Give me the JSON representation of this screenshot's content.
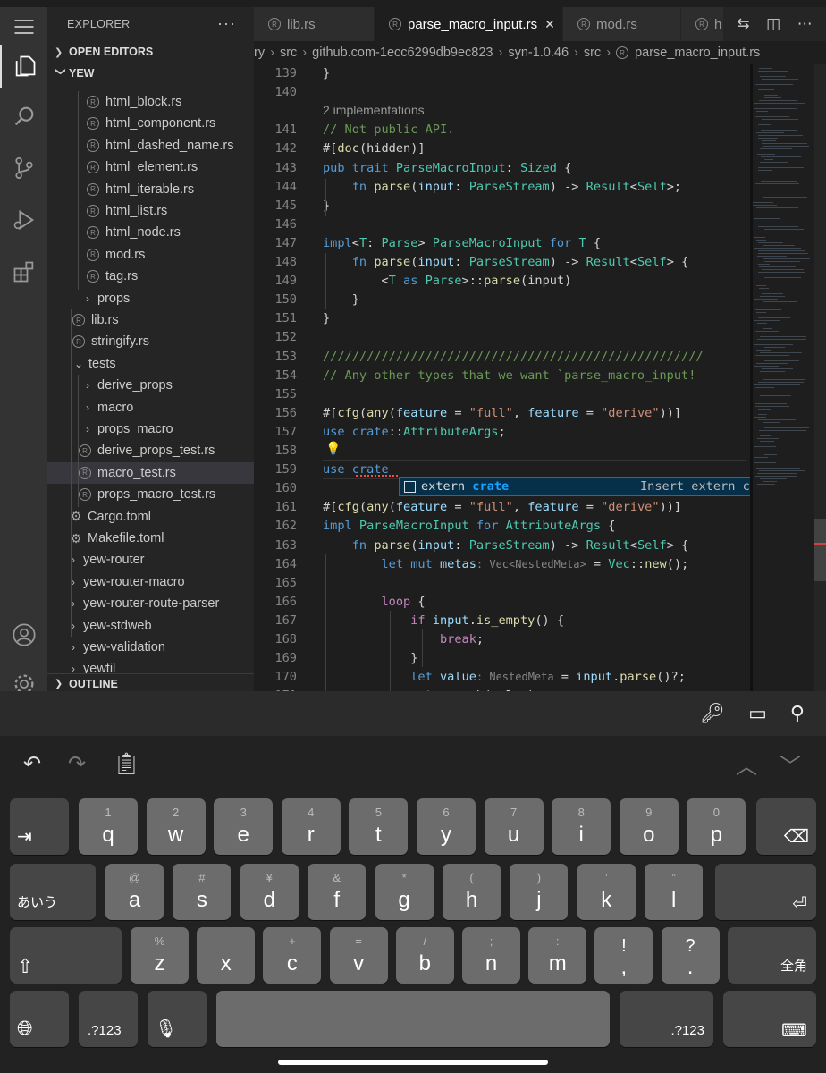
{
  "sidebar": {
    "title": "EXPLORER",
    "sections": {
      "open_editors": "OPEN EDITORS",
      "project": "YEW",
      "outline": "OUTLINE"
    },
    "items": [
      {
        "label": "html_block.rs",
        "kind": "rust"
      },
      {
        "label": "html_component.rs",
        "kind": "rust"
      },
      {
        "label": "html_dashed_name.rs",
        "kind": "rust"
      },
      {
        "label": "html_element.rs",
        "kind": "rust"
      },
      {
        "label": "html_iterable.rs",
        "kind": "rust"
      },
      {
        "label": "html_list.rs",
        "kind": "rust"
      },
      {
        "label": "html_node.rs",
        "kind": "rust"
      },
      {
        "label": "mod.rs",
        "kind": "rust"
      },
      {
        "label": "tag.rs",
        "kind": "rust"
      },
      {
        "label": "props",
        "kind": "folder"
      },
      {
        "label": "lib.rs",
        "kind": "rust"
      },
      {
        "label": "stringify.rs",
        "kind": "rust"
      },
      {
        "label": "tests",
        "kind": "folder-open"
      },
      {
        "label": "derive_props",
        "kind": "folder"
      },
      {
        "label": "macro",
        "kind": "folder"
      },
      {
        "label": "props_macro",
        "kind": "folder"
      },
      {
        "label": "derive_props_test.rs",
        "kind": "rust"
      },
      {
        "label": "macro_test.rs",
        "kind": "rust",
        "selected": true
      },
      {
        "label": "props_macro_test.rs",
        "kind": "rust"
      },
      {
        "label": "Cargo.toml",
        "kind": "config"
      },
      {
        "label": "Makefile.toml",
        "kind": "config"
      },
      {
        "label": "yew-router",
        "kind": "folder"
      },
      {
        "label": "yew-router-macro",
        "kind": "folder"
      },
      {
        "label": "yew-router-route-parser",
        "kind": "folder"
      },
      {
        "label": "yew-stdweb",
        "kind": "folder"
      },
      {
        "label": "yew-validation",
        "kind": "folder"
      },
      {
        "label": "yewtil",
        "kind": "folder"
      }
    ]
  },
  "tabs": [
    {
      "label": "lib.rs"
    },
    {
      "label": "parse_macro_input.rs",
      "active": true
    },
    {
      "label": "mod.rs"
    },
    {
      "label": "h"
    }
  ],
  "breadcrumb": [
    "ry",
    "src",
    "github.com-1ecc6299db9ec823",
    "syn-1.0.46",
    "src",
    "parse_macro_input.rs"
  ],
  "editor": {
    "codelens": "2 implementations",
    "lines": [
      {
        "n": "139",
        "t": [
          [
            "}",
            "pu"
          ]
        ]
      },
      {
        "n": "140",
        "t": []
      },
      {
        "n": "141",
        "t": [
          [
            "// Not public API.",
            "cm"
          ]
        ]
      },
      {
        "n": "142",
        "t": [
          [
            "#[",
            "pu"
          ],
          [
            "doc",
            "fn"
          ],
          [
            "(hidden)]",
            "pu"
          ]
        ]
      },
      {
        "n": "143",
        "t": [
          [
            "pub trait ",
            "kw"
          ],
          [
            "ParseMacroInput",
            "ty"
          ],
          [
            ": ",
            "pu"
          ],
          [
            "Sized",
            "ty"
          ],
          [
            " {",
            "pu"
          ]
        ]
      },
      {
        "n": "144",
        "t": [
          [
            "    ",
            "pu"
          ],
          [
            "fn ",
            "kw"
          ],
          [
            "parse",
            "fn"
          ],
          [
            "(",
            "pu"
          ],
          [
            "input",
            "vr"
          ],
          [
            ": ",
            "pu"
          ],
          [
            "ParseStream",
            "ty"
          ],
          [
            ") -> ",
            "pu"
          ],
          [
            "Result",
            "ty"
          ],
          [
            "<",
            "pu"
          ],
          [
            "Self",
            "ty"
          ],
          [
            ">;",
            "pu"
          ]
        ]
      },
      {
        "n": "145",
        "t": [
          [
            "}",
            "pu"
          ]
        ]
      },
      {
        "n": "146",
        "t": []
      },
      {
        "n": "147",
        "t": [
          [
            "impl",
            "kw"
          ],
          [
            "<",
            "pu"
          ],
          [
            "T",
            "ty"
          ],
          [
            ": ",
            "pu"
          ],
          [
            "Parse",
            "ty"
          ],
          [
            "> ",
            "pu"
          ],
          [
            "ParseMacroInput",
            "ty"
          ],
          [
            " for ",
            "kw"
          ],
          [
            "T",
            "ty"
          ],
          [
            " {",
            "pu"
          ]
        ]
      },
      {
        "n": "148",
        "t": [
          [
            "    ",
            "pu"
          ],
          [
            "fn ",
            "kw"
          ],
          [
            "parse",
            "fn"
          ],
          [
            "(",
            "pu"
          ],
          [
            "input",
            "vr"
          ],
          [
            ": ",
            "pu"
          ],
          [
            "ParseStream",
            "ty"
          ],
          [
            ") -> ",
            "pu"
          ],
          [
            "Result",
            "ty"
          ],
          [
            "<",
            "pu"
          ],
          [
            "Self",
            "ty"
          ],
          [
            "> {",
            "pu"
          ]
        ]
      },
      {
        "n": "149",
        "t": [
          [
            "        <",
            "pu"
          ],
          [
            "T",
            "ty"
          ],
          [
            " as ",
            "kw"
          ],
          [
            "Parse",
            "ty"
          ],
          [
            ">::",
            "pu"
          ],
          [
            "parse",
            "fn"
          ],
          [
            "(input)",
            "pu"
          ]
        ]
      },
      {
        "n": "150",
        "t": [
          [
            "    }",
            "pu"
          ]
        ]
      },
      {
        "n": "151",
        "t": [
          [
            "}",
            "pu"
          ]
        ]
      },
      {
        "n": "152",
        "t": []
      },
      {
        "n": "153",
        "t": [
          [
            "////////////////////////////////////////////////////",
            "cm"
          ]
        ]
      },
      {
        "n": "154",
        "t": [
          [
            "// Any other types that we want `parse_macro_input!",
            "cm"
          ]
        ]
      },
      {
        "n": "155",
        "t": []
      },
      {
        "n": "156",
        "t": [
          [
            "#[",
            "pu"
          ],
          [
            "cfg",
            "fn"
          ],
          [
            "(",
            "pu"
          ],
          [
            "any",
            "fn"
          ],
          [
            "(",
            "pu"
          ],
          [
            "feature",
            "vr"
          ],
          [
            " = ",
            "pu"
          ],
          [
            "\"full\"",
            "st"
          ],
          [
            ", ",
            "pu"
          ],
          [
            "feature",
            "vr"
          ],
          [
            " = ",
            "pu"
          ],
          [
            "\"derive\"",
            "st"
          ],
          [
            "))]",
            "pu"
          ]
        ]
      },
      {
        "n": "157",
        "t": [
          [
            "use ",
            "kw"
          ],
          [
            "crate",
            "kw"
          ],
          [
            "::",
            "pu"
          ],
          [
            "AttributeArgs",
            "ty"
          ],
          [
            ";",
            "pu"
          ]
        ]
      },
      {
        "n": "158",
        "t": []
      },
      {
        "n": "159",
        "t": [
          [
            "use ",
            "kw"
          ],
          [
            "crate",
            "kw"
          ]
        ]
      },
      {
        "n": "160",
        "t": []
      },
      {
        "n": "161",
        "t": [
          [
            "#[",
            "pu"
          ],
          [
            "cfg",
            "fn"
          ],
          [
            "(",
            "pu"
          ],
          [
            "any",
            "fn"
          ],
          [
            "(",
            "pu"
          ],
          [
            "feature",
            "vr"
          ],
          [
            " = ",
            "pu"
          ],
          [
            "\"full\"",
            "st"
          ],
          [
            ", ",
            "pu"
          ],
          [
            "feature",
            "vr"
          ],
          [
            " = ",
            "pu"
          ],
          [
            "\"derive\"",
            "st"
          ],
          [
            "))]",
            "pu"
          ]
        ]
      },
      {
        "n": "162",
        "t": [
          [
            "impl ",
            "kw"
          ],
          [
            "ParseMacroInput",
            "ty"
          ],
          [
            " for ",
            "kw"
          ],
          [
            "AttributeArgs",
            "ty"
          ],
          [
            " {",
            "pu"
          ]
        ]
      },
      {
        "n": "163",
        "t": [
          [
            "    ",
            "pu"
          ],
          [
            "fn ",
            "kw"
          ],
          [
            "parse",
            "fn"
          ],
          [
            "(",
            "pu"
          ],
          [
            "input",
            "vr"
          ],
          [
            ": ",
            "pu"
          ],
          [
            "ParseStream",
            "ty"
          ],
          [
            ") -> ",
            "pu"
          ],
          [
            "Result",
            "ty"
          ],
          [
            "<",
            "pu"
          ],
          [
            "Self",
            "ty"
          ],
          [
            "> {",
            "pu"
          ]
        ]
      },
      {
        "n": "164",
        "t": [
          [
            "        ",
            "pu"
          ],
          [
            "let ",
            "kw"
          ],
          [
            "mut ",
            "kw"
          ],
          [
            "metas",
            "vr"
          ],
          [
            ": ",
            "dim"
          ],
          [
            "Vec<NestedMeta>",
            "dim"
          ],
          [
            " = ",
            "pu"
          ],
          [
            "Vec",
            "ty"
          ],
          [
            "::",
            "pu"
          ],
          [
            "new",
            "fn"
          ],
          [
            "();",
            "pu"
          ]
        ]
      },
      {
        "n": "165",
        "t": []
      },
      {
        "n": "166",
        "t": [
          [
            "        ",
            "pu"
          ],
          [
            "loop",
            "mc"
          ],
          [
            " {",
            "pu"
          ]
        ]
      },
      {
        "n": "167",
        "t": [
          [
            "            ",
            "pu"
          ],
          [
            "if ",
            "mc"
          ],
          [
            "input",
            "vr"
          ],
          [
            ".",
            "pu"
          ],
          [
            "is_empty",
            "fn"
          ],
          [
            "() {",
            "pu"
          ]
        ]
      },
      {
        "n": "168",
        "t": [
          [
            "                ",
            "pu"
          ],
          [
            "break",
            "mc"
          ],
          [
            ";",
            "pu"
          ]
        ]
      },
      {
        "n": "169",
        "t": [
          [
            "            }",
            "pu"
          ]
        ]
      },
      {
        "n": "170",
        "t": [
          [
            "            ",
            "pu"
          ],
          [
            "let ",
            "kw"
          ],
          [
            "value",
            "vr"
          ],
          [
            ": ",
            "dim"
          ],
          [
            "NestedMeta",
            "dim"
          ],
          [
            " = ",
            "pu"
          ],
          [
            "input",
            "vr"
          ],
          [
            ".",
            "pu"
          ],
          [
            "parse",
            "fn"
          ],
          [
            "()?;",
            "pu"
          ]
        ]
      },
      {
        "n": "171",
        "t": [
          [
            "            ",
            "pu"
          ],
          [
            "metas",
            "vr"
          ],
          [
            ".",
            "pu"
          ],
          [
            "push",
            "fn"
          ],
          [
            "(value);",
            "pu"
          ]
        ]
      }
    ],
    "suggestion": {
      "prefix": "extern ",
      "match": "crate",
      "detail": "Insert extern crate…"
    }
  },
  "keyboard": {
    "row1": [
      [
        "q",
        "1"
      ],
      [
        "w",
        "2"
      ],
      [
        "e",
        "3"
      ],
      [
        "r",
        "4"
      ],
      [
        "t",
        "5"
      ],
      [
        "y",
        "6"
      ],
      [
        "u",
        "7"
      ],
      [
        "i",
        "8"
      ],
      [
        "o",
        "9"
      ],
      [
        "p",
        "0"
      ]
    ],
    "row2": [
      [
        "a",
        "@"
      ],
      [
        "s",
        "#"
      ],
      [
        "d",
        "¥"
      ],
      [
        "f",
        "&"
      ],
      [
        "g",
        "*"
      ],
      [
        "h",
        "("
      ],
      [
        "j",
        ")"
      ],
      [
        "k",
        "’"
      ],
      [
        "l",
        "”"
      ]
    ],
    "row3": [
      [
        "z",
        "%"
      ],
      [
        "x",
        "-"
      ],
      [
        "c",
        "+"
      ],
      [
        "v",
        "="
      ],
      [
        "b",
        "/"
      ],
      [
        "n",
        ";"
      ],
      [
        "m",
        ":"
      ],
      [
        ",",
        "!"
      ],
      [
        ".",
        "?"
      ]
    ],
    "kana_label": "あいう",
    "zenkaku_label": "全角",
    "num_label": ".?123"
  },
  "colors": {
    "accent": "#0a70c4",
    "selection": "#37373d"
  }
}
